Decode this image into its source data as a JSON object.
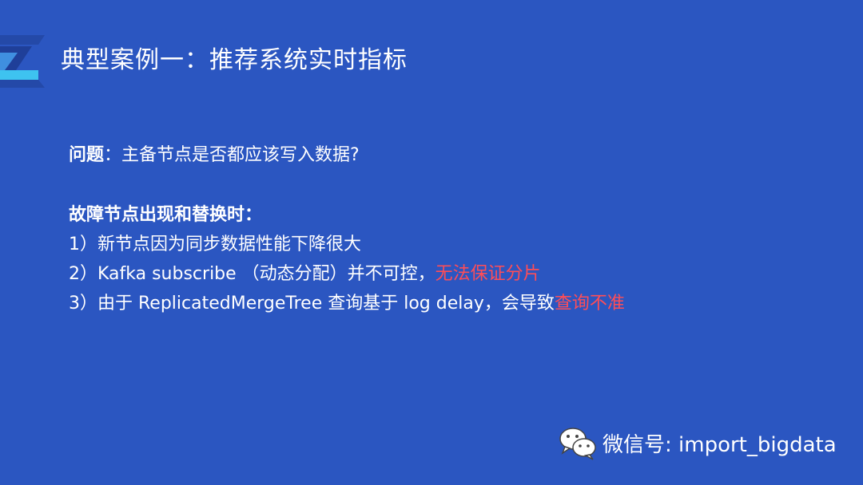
{
  "title": "典型案例一：推荐系统实时指标",
  "question": {
    "label": "问题",
    "text": "：主备节点是否都应该写入数据?"
  },
  "section_heading": "故障节点出现和替换时：",
  "items": [
    {
      "prefix": "1）新节点因为同步数据性能下降很大",
      "highlight": ""
    },
    {
      "prefix": "2）Kafka subscribe （动态分配）并不可控，",
      "highlight": "无法保证分片"
    },
    {
      "prefix": "3）由于 ReplicatedMergeTree 查询基于 log delay，会导致",
      "highlight": "查询不准"
    }
  ],
  "footer": {
    "icon": "wechat-icon",
    "text": "微信号: import_bigdata"
  },
  "colors": {
    "background": "#2b56c1",
    "text": "#ffffff",
    "highlight": "#ff4d57",
    "decor_light": "#3ec3f0",
    "decor_dark": "#1f3f99"
  }
}
